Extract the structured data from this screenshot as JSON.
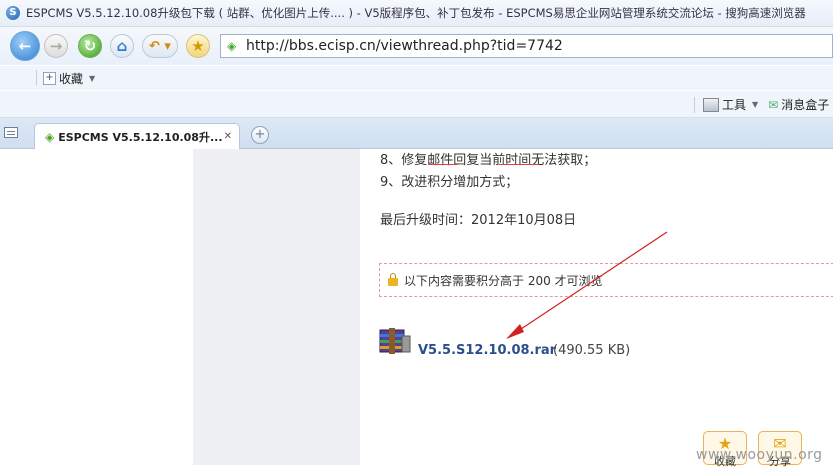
{
  "window": {
    "title": "ESPCMS V5.5.12.10.08升级包下载 ( 站群、优化图片上传.... ) - V5版程序包、补丁包发布 - ESPCMS易思企业网站管理系统交流论坛 - 搜狗高速浏览器"
  },
  "navbar": {
    "url": "http://bbs.ecisp.cn/viewthread.php?tid=7742"
  },
  "favbar": {
    "favorites_label": "收藏"
  },
  "toolsbar": {
    "tools_label": "工具",
    "messages_label": "消息盒子"
  },
  "tabs": [
    {
      "title": "ESPCMS V5.5.12.10.08升...",
      "active": true
    }
  ],
  "content": {
    "lines": [
      "8、修复邮件回复当前时间无法获取；",
      "9、改进积分增加方式；"
    ],
    "update_time": "最后升级时间：2012年10月08日",
    "locked_notice": "以下内容需要积分高于 200 才可浏览",
    "attachment": {
      "filename": "V5.5.S12.10.08.rar",
      "size": "(490.55 KB)"
    }
  },
  "floating_buttons": {
    "favorite_label": "收藏",
    "share_label": "分享"
  },
  "watermark": "www.wooyun.org",
  "colors": {
    "annotation_red": "#d42020",
    "link_blue": "#2b4f8c"
  }
}
